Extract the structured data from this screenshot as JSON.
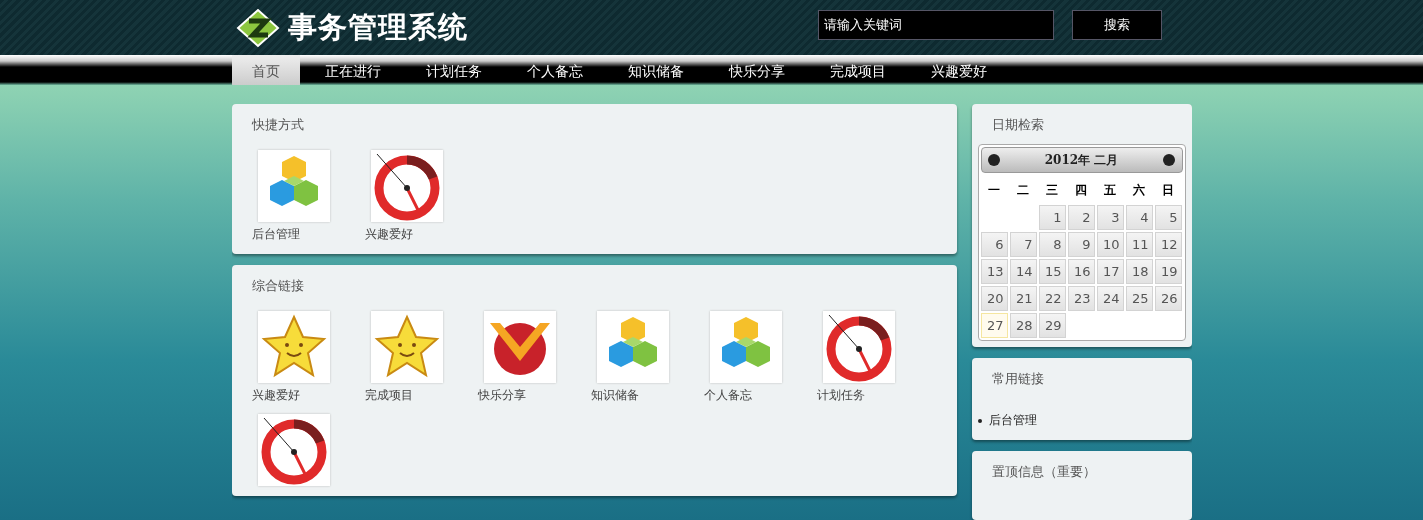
{
  "header": {
    "title": "事务管理系统",
    "search": {
      "placeholder": "请输入关键词"
    },
    "search_button": "搜索"
  },
  "nav": [
    {
      "label": "首页",
      "selected": true
    },
    {
      "label": "正在进行",
      "selected": false
    },
    {
      "label": "计划任务",
      "selected": false
    },
    {
      "label": "个人备忘",
      "selected": false
    },
    {
      "label": "知识储备",
      "selected": false
    },
    {
      "label": "快乐分享",
      "selected": false
    },
    {
      "label": "完成项目",
      "selected": false
    },
    {
      "label": "兴趣爱好",
      "selected": false
    }
  ],
  "shortcuts": {
    "title": "快捷方式",
    "items": [
      {
        "label": "后台管理",
        "kind": "cubes"
      },
      {
        "label": "兴趣爱好",
        "kind": "gauge"
      }
    ]
  },
  "links": {
    "title": "综合链接",
    "items": [
      {
        "label": "兴趣爱好",
        "kind": "star"
      },
      {
        "label": "完成项目",
        "kind": "star"
      },
      {
        "label": "快乐分享",
        "kind": "v"
      },
      {
        "label": "知识储备",
        "kind": "cubes"
      },
      {
        "label": "个人备忘",
        "kind": "cubes"
      },
      {
        "label": "计划任务",
        "kind": "gauge"
      },
      {
        "kind": "gauge"
      }
    ]
  },
  "calendar": {
    "title": "日期检索",
    "month": "2012年 二月",
    "weekdays": [
      "一",
      "二",
      "三",
      "四",
      "五",
      "六",
      "日"
    ],
    "weeks": [
      [
        {
          "day": "1",
          "today": false
        },
        {
          "day": "2",
          "today": false
        },
        {
          "day": "3",
          "today": false
        },
        {
          "day": "4",
          "today": false
        },
        {
          "day": "5",
          "today": false
        }
      ],
      [
        {
          "day": "6",
          "today": false
        },
        {
          "day": "7",
          "today": false
        },
        {
          "day": "8",
          "today": false
        },
        {
          "day": "9",
          "today": false
        },
        {
          "day": "10",
          "today": false
        },
        {
          "day": "11",
          "today": false
        },
        {
          "day": "12",
          "today": false
        }
      ],
      [
        {
          "day": "13",
          "today": false
        },
        {
          "day": "14",
          "today": false
        },
        {
          "day": "15",
          "today": false
        },
        {
          "day": "16",
          "today": false
        },
        {
          "day": "17",
          "today": false
        },
        {
          "day": "18",
          "today": false
        },
        {
          "day": "19",
          "today": false
        }
      ],
      [
        {
          "day": "20",
          "today": false
        },
        {
          "day": "21",
          "today": false
        },
        {
          "day": "22",
          "today": false
        },
        {
          "day": "23",
          "today": false
        },
        {
          "day": "24",
          "today": false
        },
        {
          "day": "25",
          "today": false
        },
        {
          "day": "26",
          "today": false
        }
      ],
      [
        {
          "day": "27",
          "today": true
        },
        {
          "day": "28",
          "today": false
        },
        {
          "day": "29",
          "today": false
        }
      ]
    ]
  },
  "common_links": {
    "title": "常用链接",
    "items": [
      "后台管理"
    ]
  },
  "pinned": {
    "title": "置顶信息（重要）"
  }
}
